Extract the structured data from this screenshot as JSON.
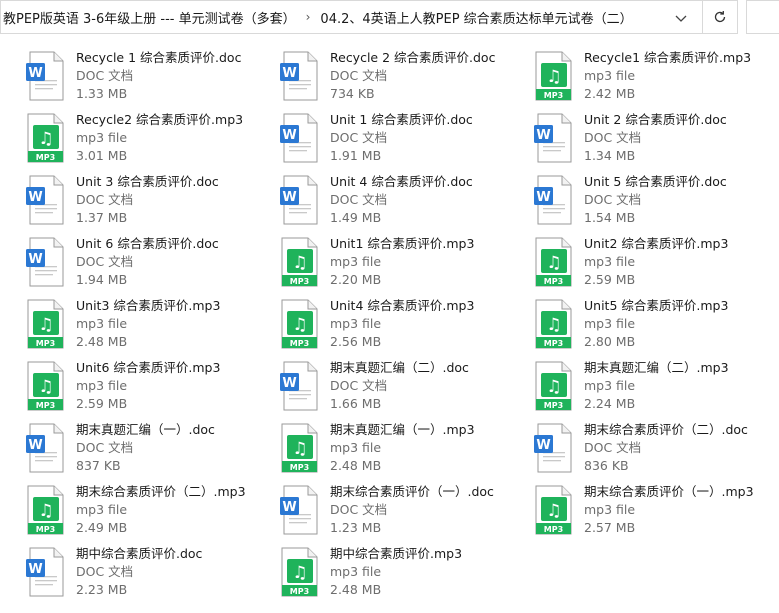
{
  "addressbar": {
    "crumbs": [
      "教PEP版英语 3-6年级上册 --- 单元测试卷（多套）",
      "04.2、4英语上人教PEP 综合素质达标单元试卷（二）"
    ],
    "separator": "›"
  },
  "colors": {
    "doc_blue": "#2b78d3",
    "mp3_green": "#1fb35b"
  },
  "files": [
    {
      "name": "Recycle 1  综合素质评价.doc",
      "type": "DOC 文档",
      "size": "1.33 MB",
      "kind": "doc"
    },
    {
      "name": "Recycle 2  综合素质评价.doc",
      "type": "DOC 文档",
      "size": "734 KB",
      "kind": "doc"
    },
    {
      "name": "Recycle1 综合素质评价.mp3",
      "type": "mp3 file",
      "size": "2.42 MB",
      "kind": "mp3"
    },
    {
      "name": "Recycle2 综合素质评价.mp3",
      "type": "mp3 file",
      "size": "3.01 MB",
      "kind": "mp3"
    },
    {
      "name": "Unit 1 综合素质评价.doc",
      "type": "DOC 文档",
      "size": "1.91 MB",
      "kind": "doc"
    },
    {
      "name": "Unit 2 综合素质评价.doc",
      "type": "DOC 文档",
      "size": "1.34 MB",
      "kind": "doc"
    },
    {
      "name": "Unit 3 综合素质评价.doc",
      "type": "DOC 文档",
      "size": "1.37 MB",
      "kind": "doc"
    },
    {
      "name": "Unit 4 综合素质评价.doc",
      "type": "DOC 文档",
      "size": "1.49 MB",
      "kind": "doc"
    },
    {
      "name": "Unit 5 综合素质评价.doc",
      "type": "DOC 文档",
      "size": "1.54 MB",
      "kind": "doc"
    },
    {
      "name": "Unit 6 综合素质评价.doc",
      "type": "DOC 文档",
      "size": "1.94 MB",
      "kind": "doc"
    },
    {
      "name": "Unit1 综合素质评价.mp3",
      "type": "mp3 file",
      "size": "2.20 MB",
      "kind": "mp3"
    },
    {
      "name": "Unit2 综合素质评价.mp3",
      "type": "mp3 file",
      "size": "2.59 MB",
      "kind": "mp3"
    },
    {
      "name": "Unit3 综合素质评价.mp3",
      "type": "mp3 file",
      "size": "2.48 MB",
      "kind": "mp3"
    },
    {
      "name": "Unit4 综合素质评价.mp3",
      "type": "mp3 file",
      "size": "2.56 MB",
      "kind": "mp3"
    },
    {
      "name": "Unit5 综合素质评价.mp3",
      "type": "mp3 file",
      "size": "2.80 MB",
      "kind": "mp3"
    },
    {
      "name": "Unit6 综合素质评价.mp3",
      "type": "mp3 file",
      "size": "2.59 MB",
      "kind": "mp3"
    },
    {
      "name": "期末真题汇编（二）.doc",
      "type": "DOC 文档",
      "size": "1.66 MB",
      "kind": "doc"
    },
    {
      "name": "期末真题汇编（二）.mp3",
      "type": "mp3 file",
      "size": "2.24 MB",
      "kind": "mp3"
    },
    {
      "name": "期末真题汇编（一）.doc",
      "type": "DOC 文档",
      "size": "837 KB",
      "kind": "doc"
    },
    {
      "name": "期末真题汇编（一）.mp3",
      "type": "mp3 file",
      "size": "2.48 MB",
      "kind": "mp3"
    },
    {
      "name": "期末综合素质评价（二）.doc",
      "type": "DOC 文档",
      "size": "836 KB",
      "kind": "doc"
    },
    {
      "name": "期末综合素质评价（二）.mp3",
      "type": "mp3 file",
      "size": "2.49 MB",
      "kind": "mp3"
    },
    {
      "name": "期末综合素质评价（一）.doc",
      "type": "DOC 文档",
      "size": "1.23 MB",
      "kind": "doc"
    },
    {
      "name": "期末综合素质评价（一）.mp3",
      "type": "mp3 file",
      "size": "2.57 MB",
      "kind": "mp3"
    },
    {
      "name": "期中综合素质评价.doc",
      "type": "DOC 文档",
      "size": "2.23 MB",
      "kind": "doc"
    },
    {
      "name": "期中综合素质评价.mp3",
      "type": "mp3 file",
      "size": "2.48 MB",
      "kind": "mp3"
    }
  ],
  "icons": {
    "doc_letter": "W",
    "mp3_label": "MP3",
    "mp3_glyph": "♫"
  }
}
